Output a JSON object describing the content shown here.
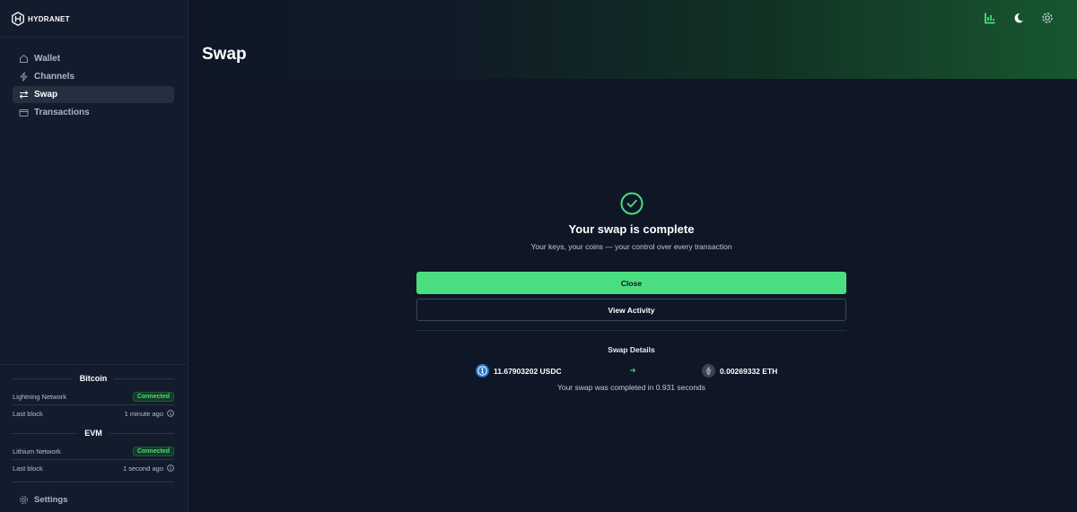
{
  "app": {
    "logo_text": "HYDRANET"
  },
  "sidebar": {
    "nav": [
      {
        "label": "Wallet",
        "icon": "home-icon"
      },
      {
        "label": "Channels",
        "icon": "lightning-icon"
      },
      {
        "label": "Swap",
        "icon": "swap-arrows-icon",
        "active": true
      },
      {
        "label": "Transactions",
        "icon": "wallet-card-icon"
      }
    ],
    "status": {
      "bitcoin": {
        "title": "Bitcoin",
        "network_label": "Lightning Network",
        "network_status": "Connected",
        "block_label": "Last block",
        "block_value": "1 minute ago"
      },
      "evm": {
        "title": "EVM",
        "network_label": "Lithium Network",
        "network_status": "Connected",
        "block_label": "Last block",
        "block_value": "1 second ago"
      }
    },
    "settings_label": "Settings"
  },
  "header": {
    "title": "Swap",
    "icons": [
      "chart-icon",
      "moon-icon",
      "gear-icon"
    ]
  },
  "result": {
    "title": "Your swap is complete",
    "subtitle": "Your keys, your coins — your control over every transaction",
    "close_label": "Close",
    "view_activity_label": "View Activity",
    "details_title": "Swap Details",
    "from_amount": "11.67903202 USDC",
    "to_amount": "0.00269332 ETH",
    "duration_text": "Your swap was completed in 0.931 seconds"
  },
  "colors": {
    "accent": "#4ade80",
    "background": "#0f1726",
    "sidebar": "#131c2c",
    "usdc": "#2775ca"
  }
}
